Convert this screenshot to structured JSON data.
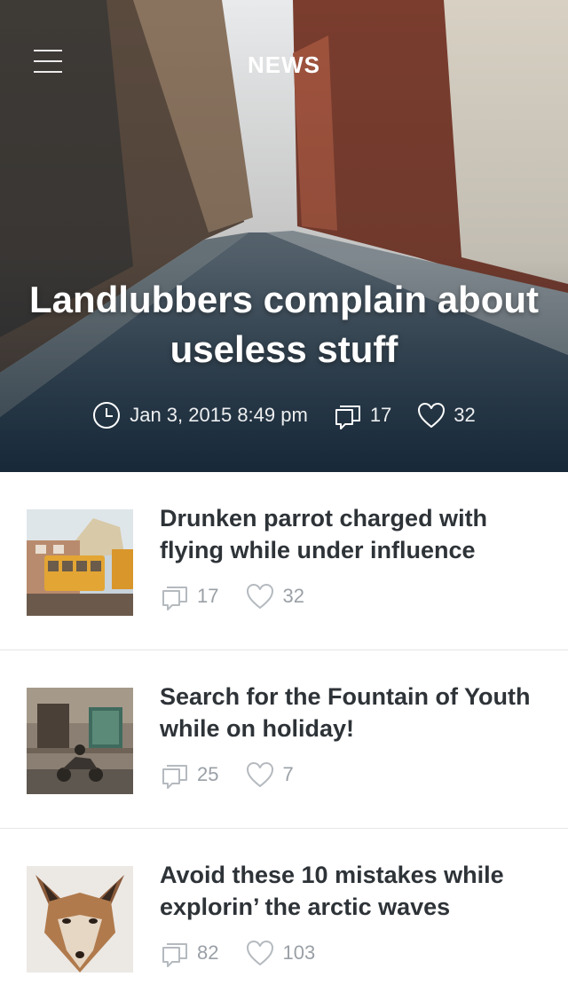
{
  "header": {
    "title": "NEWS",
    "menu_icon": "hamburger-menu-icon"
  },
  "featured": {
    "headline": "Landlubbers complain about useless stuff",
    "date": "Jan 3, 2015 8:49 pm",
    "comments": "17",
    "likes": "32",
    "icons": {
      "date": "clock-icon",
      "comments": "comment-icon",
      "likes": "heart-icon"
    }
  },
  "articles": [
    {
      "title": "Drunken parrot charged with flying while under influence",
      "comments": "17",
      "likes": "32",
      "thumbnail": "tram-street-photo"
    },
    {
      "title": "Search for the Fountain of Youth while on holiday!",
      "comments": "25",
      "likes": "7",
      "thumbnail": "old-building-scooter-photo"
    },
    {
      "title": "Avoid these 10 mistakes while explorin’ the arctic waves",
      "comments": "82",
      "likes": "103",
      "thumbnail": "fox-portrait-photo"
    }
  ],
  "colors": {
    "title_text": "#2e3338",
    "meta_text": "#9aa0a6",
    "divider": "#e6e6e6",
    "hero_text": "#ffffff"
  }
}
